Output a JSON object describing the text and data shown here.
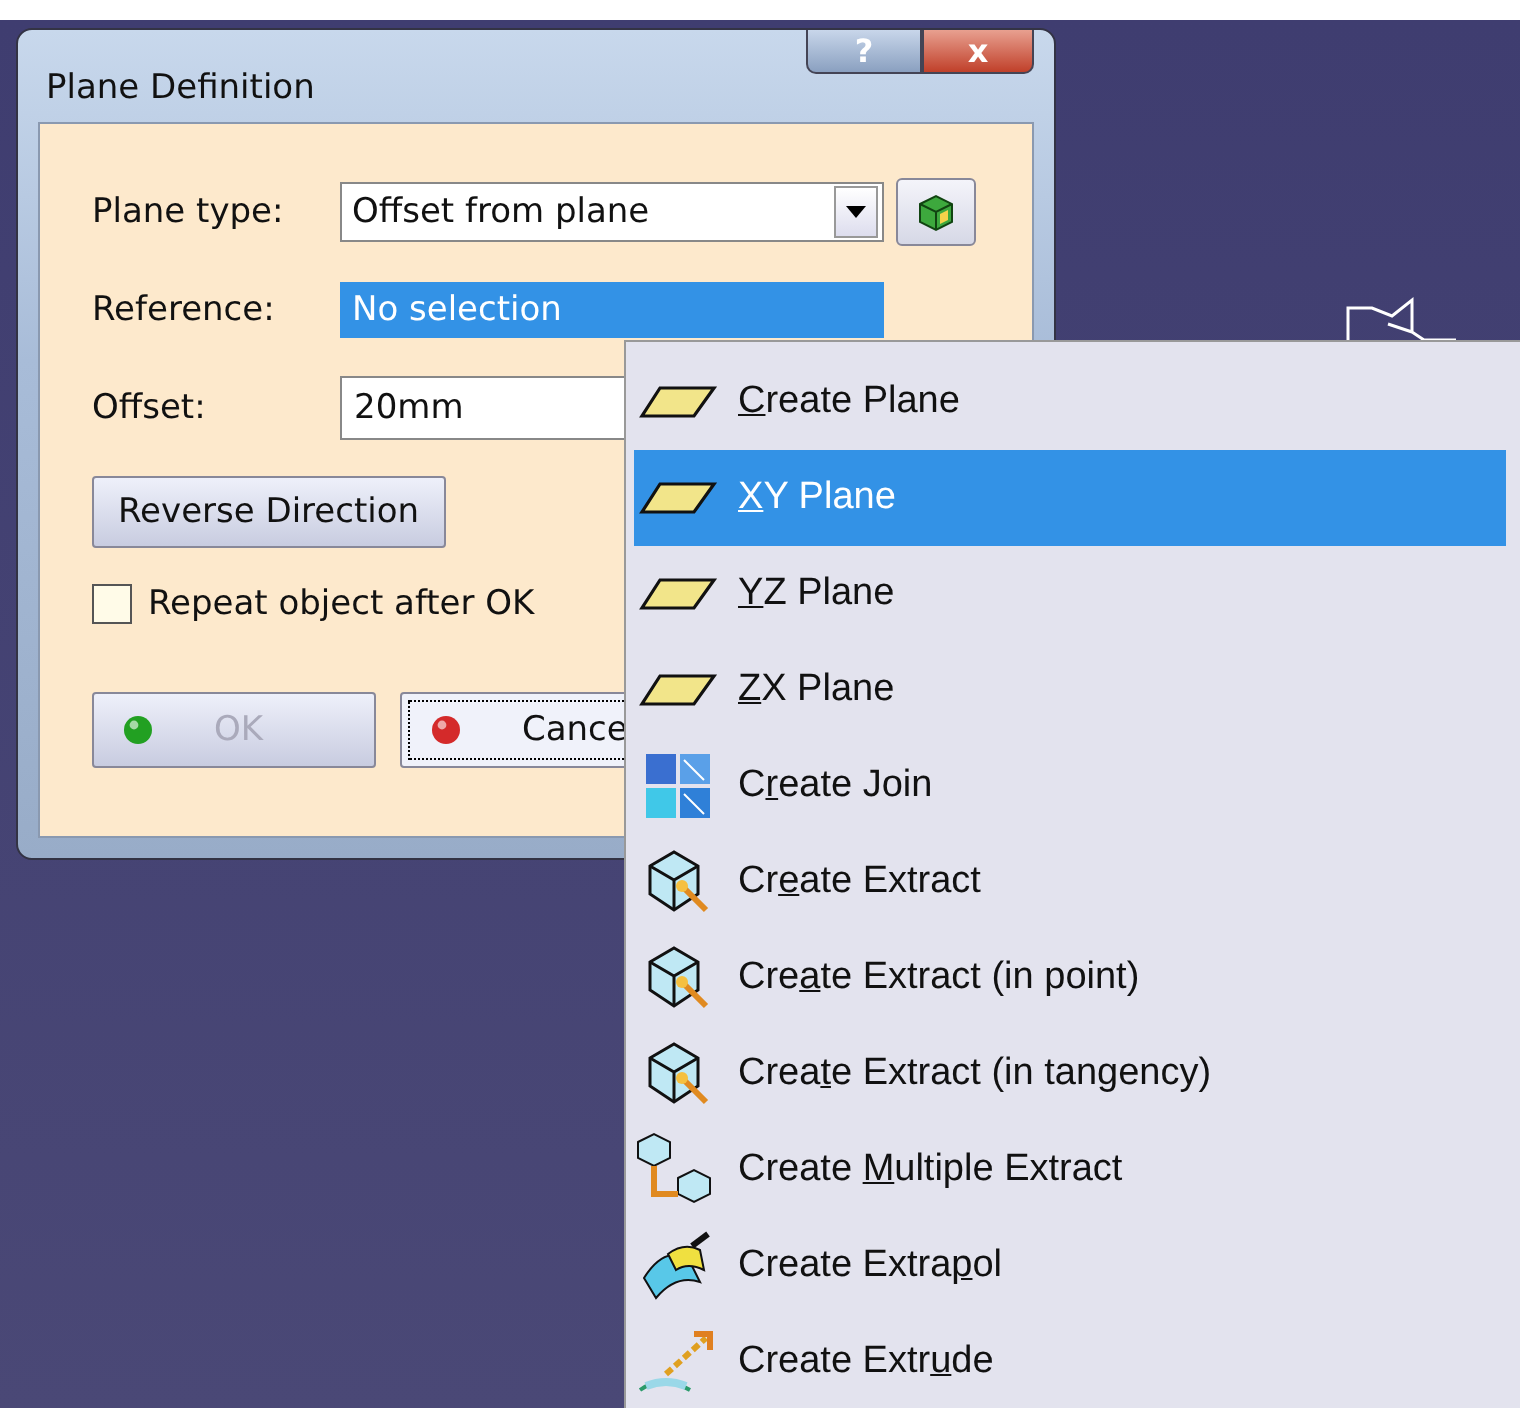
{
  "dialog": {
    "title": "Plane Definition",
    "title_buttons": [
      {
        "kind": "help",
        "glyph": "?"
      },
      {
        "kind": "close",
        "glyph": "x"
      }
    ],
    "plane_type": {
      "label": "Plane type:",
      "value": "Offset from plane"
    },
    "reference": {
      "label": "Reference:",
      "value": "No selection",
      "highlighted": true
    },
    "offset": {
      "label": "Offset:",
      "value": "20mm"
    },
    "reverse_button": "Reverse Direction",
    "repeat": {
      "label": "Repeat object after OK",
      "checked": false
    },
    "buttons": [
      {
        "kind": "ok",
        "label": "OK",
        "disabled": true,
        "focused": false
      },
      {
        "kind": "cancel",
        "label": "Cance",
        "disabled": false,
        "focused": true
      }
    ]
  },
  "context_menu": {
    "items": [
      {
        "kind": "plane",
        "key": "C",
        "after": "reate Plane",
        "selected": false
      },
      {
        "kind": "plane",
        "key": "X",
        "after": "Y Plane",
        "selected": true
      },
      {
        "kind": "plane",
        "key": "Y",
        "after": "Z Plane",
        "selected": false
      },
      {
        "kind": "plane",
        "key": "Z",
        "after": "X Plane",
        "selected": false
      },
      {
        "kind": "join",
        "before": "C",
        "key": "r",
        "after": "eate Join",
        "selected": false
      },
      {
        "kind": "extract",
        "before": "Cr",
        "key": "e",
        "after": "ate Extract",
        "selected": false
      },
      {
        "kind": "extract",
        "before": "Cre",
        "key": "a",
        "after": "te Extract (in point)",
        "selected": false
      },
      {
        "kind": "extract",
        "before": "Crea",
        "key": "t",
        "after": "e Extract (in tangency)",
        "selected": false
      },
      {
        "kind": "multi_extract",
        "before": "Create ",
        "key": "M",
        "after": "ultiple Extract",
        "selected": false
      },
      {
        "kind": "extrapol",
        "before": "Create Extra",
        "key": "p",
        "after": "ol",
        "selected": false
      },
      {
        "kind": "extrude",
        "before": "Create Extr",
        "key": "u",
        "after": "de",
        "selected": false
      }
    ]
  }
}
